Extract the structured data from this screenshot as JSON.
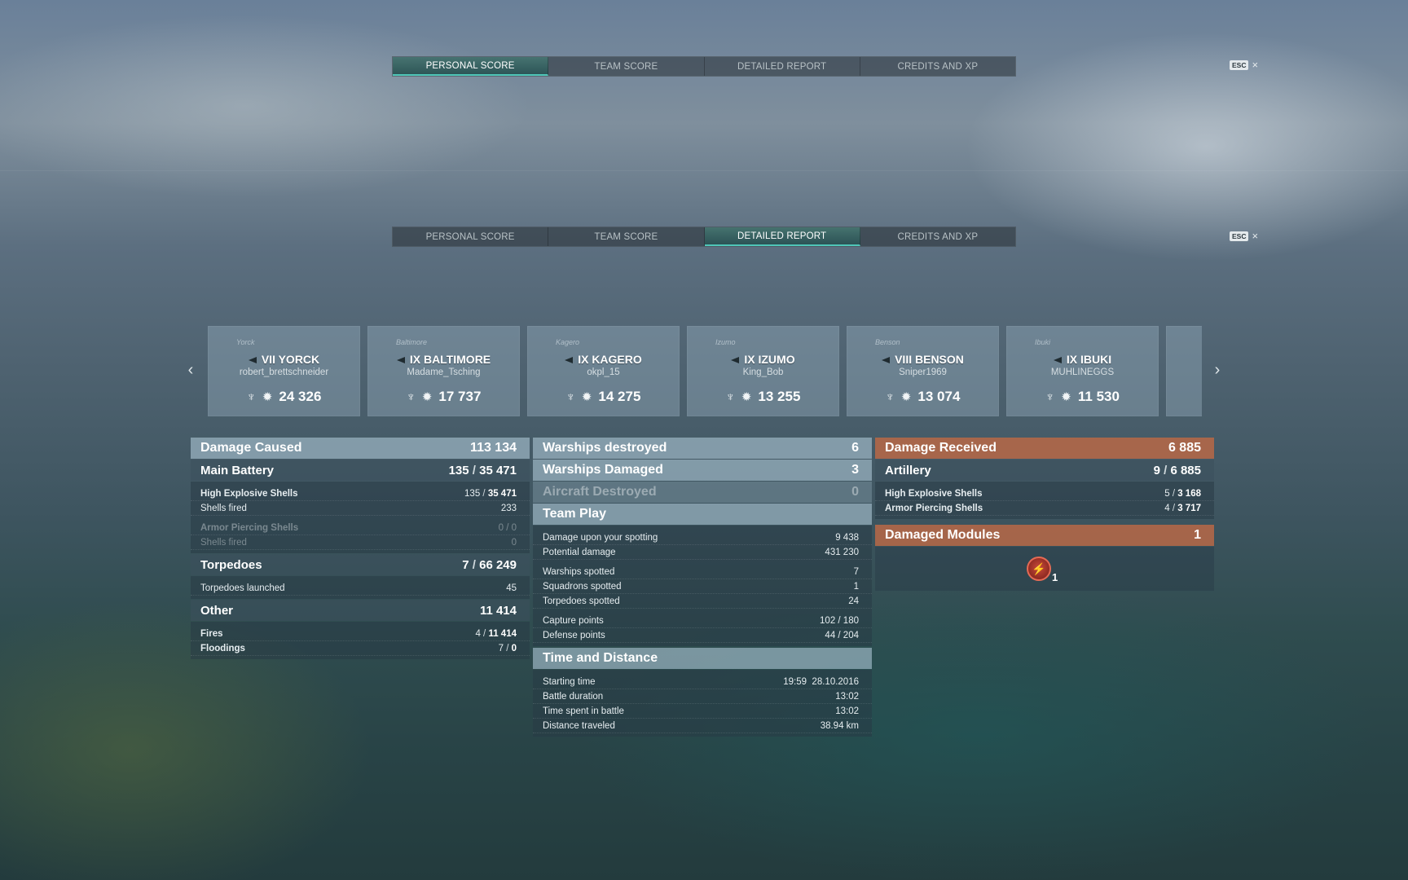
{
  "tabs": [
    "PERSONAL SCORE",
    "TEAM SCORE",
    "DETAILED REPORT",
    "CREDITS AND XP"
  ],
  "tabs_top_active": 0,
  "tabs_main_active": 2,
  "esc_label": "ESC",
  "close_glyph": "×",
  "carousel": {
    "prev_glyph": "‹",
    "next_glyph": "›",
    "ships": [
      {
        "silhouette": "Yorck",
        "name": "VII YORCK",
        "player": "robert_brettschneider",
        "score": "24 326"
      },
      {
        "silhouette": "Baltimore",
        "name": "IX BALTIMORE",
        "player": "Madame_Tsching",
        "score": "17 737"
      },
      {
        "silhouette": "Kagero",
        "name": "IX KAGERO",
        "player": "okpl_15",
        "score": "14 275"
      },
      {
        "silhouette": "Izumo",
        "name": "IX IZUMO",
        "player": "King_Bob",
        "score": "13 255"
      },
      {
        "silhouette": "Benson",
        "name": "VIII BENSON",
        "player": "Sniper1969",
        "score": "13 074"
      },
      {
        "silhouette": "Ibuki",
        "name": "IX IBUKI",
        "player": "MUHLINEGGS",
        "score": "11 530"
      }
    ]
  },
  "damage_caused": {
    "title": "Damage Caused",
    "total": "113 134",
    "main_battery": {
      "label": "Main Battery",
      "hits": "135",
      "damage": "35 471"
    },
    "he": {
      "label": "High Explosive Shells",
      "hits": "135",
      "damage": "35 471",
      "fired_label": "Shells fired",
      "fired": "233"
    },
    "ap": {
      "label": "Armor Piercing Shells",
      "hits": "0",
      "damage": "0",
      "fired_label": "Shells fired",
      "fired": "0"
    },
    "torpedoes": {
      "label": "Torpedoes",
      "hits": "7",
      "damage": "66 249",
      "launched_label": "Torpedoes launched",
      "launched": "45"
    },
    "other": {
      "label": "Other",
      "total": "11 414",
      "fires": {
        "label": "Fires",
        "count": "4",
        "damage": "11 414"
      },
      "floodings": {
        "label": "Floodings",
        "count": "7",
        "damage": "0"
      }
    }
  },
  "middle": {
    "warships_destroyed": {
      "label": "Warships destroyed",
      "value": "6"
    },
    "warships_damaged": {
      "label": "Warships Damaged",
      "value": "3"
    },
    "aircraft_destroyed": {
      "label": "Aircraft Destroyed",
      "value": "0"
    },
    "team_play": {
      "label": "Team Play",
      "rows1": [
        {
          "label": "Damage upon your spotting",
          "value": "9 438"
        },
        {
          "label": "Potential damage",
          "value": "431 230"
        }
      ],
      "rows2": [
        {
          "label": "Warships spotted",
          "value": "7"
        },
        {
          "label": "Squadrons spotted",
          "value": "1"
        },
        {
          "label": "Torpedoes spotted",
          "value": "24"
        }
      ],
      "rows3": [
        {
          "label": "Capture points",
          "value": "102 / 180"
        },
        {
          "label": "Defense points",
          "value": "44 / 204"
        }
      ]
    },
    "time_distance": {
      "label": "Time and Distance",
      "rows": [
        {
          "label": "Starting time",
          "value": "19:59  28.10.2016"
        },
        {
          "label": "Battle duration",
          "value": "13:02"
        },
        {
          "label": "Time spent in battle",
          "value": "13:02"
        },
        {
          "label": "Distance traveled",
          "value": "38.94 km"
        }
      ]
    }
  },
  "damage_received": {
    "title": "Damage Received",
    "total": "6 885",
    "artillery": {
      "label": "Artillery",
      "hits": "9",
      "damage": "6 885"
    },
    "he": {
      "label": "High Explosive Shells",
      "hits": "5",
      "damage": "3 168"
    },
    "ap": {
      "label": "Armor Piercing Shells",
      "hits": "4",
      "damage": "3 717"
    },
    "modules": {
      "label": "Damaged Modules",
      "value": "1",
      "icon_count": "1"
    }
  },
  "sep": " / "
}
